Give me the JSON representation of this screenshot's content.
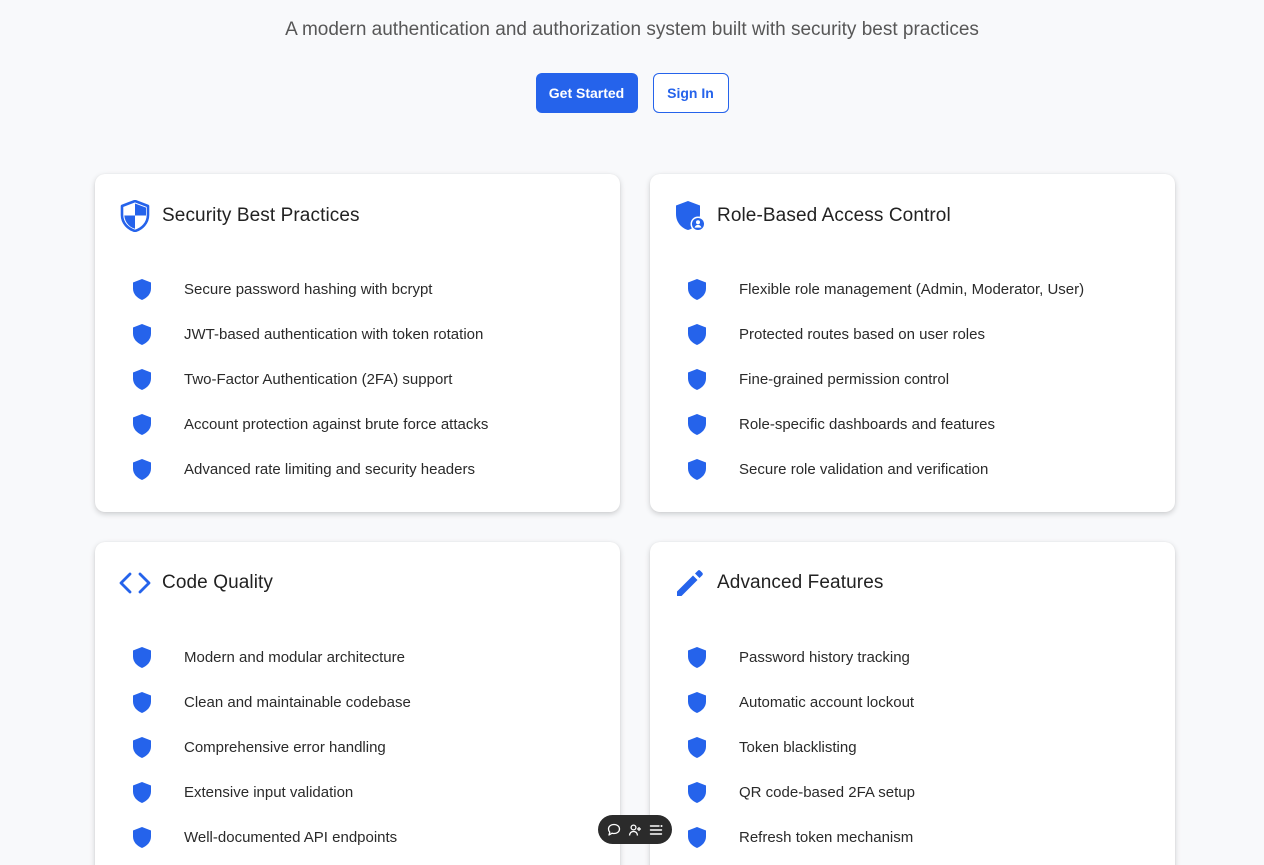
{
  "hero": {
    "subtitle": "A modern authentication and authorization system built with security best practices",
    "get_started_label": "Get Started",
    "sign_in_label": "Sign In"
  },
  "cards": [
    {
      "title": "Security Best Practices",
      "icon": "shield-half-icon",
      "features": [
        "Secure password hashing with bcrypt",
        "JWT-based authentication with token rotation",
        "Two-Factor Authentication (2FA) support",
        "Account protection against brute force attacks",
        "Advanced rate limiting and security headers"
      ]
    },
    {
      "title": "Role-Based Access Control",
      "icon": "shield-user-icon",
      "features": [
        "Flexible role management (Admin, Moderator, User)",
        "Protected routes based on user roles",
        "Fine-grained permission control",
        "Role-specific dashboards and features",
        "Secure role validation and verification"
      ]
    },
    {
      "title": "Code Quality",
      "icon": "code-icon",
      "features": [
        "Modern and modular architecture",
        "Clean and maintainable codebase",
        "Comprehensive error handling",
        "Extensive input validation",
        "Well-documented API endpoints"
      ]
    },
    {
      "title": "Advanced Features",
      "icon": "pencil-icon",
      "features": [
        "Password history tracking",
        "Automatic account lockout",
        "Token blacklisting",
        "QR code-based 2FA setup",
        "Refresh token mechanism"
      ]
    }
  ],
  "theme": {
    "accent": "#2563eb",
    "background": "#f8f9fb",
    "card": "#ffffff"
  },
  "toolbar_icons": [
    "comment-icon",
    "add-user-icon",
    "list-icon"
  ]
}
